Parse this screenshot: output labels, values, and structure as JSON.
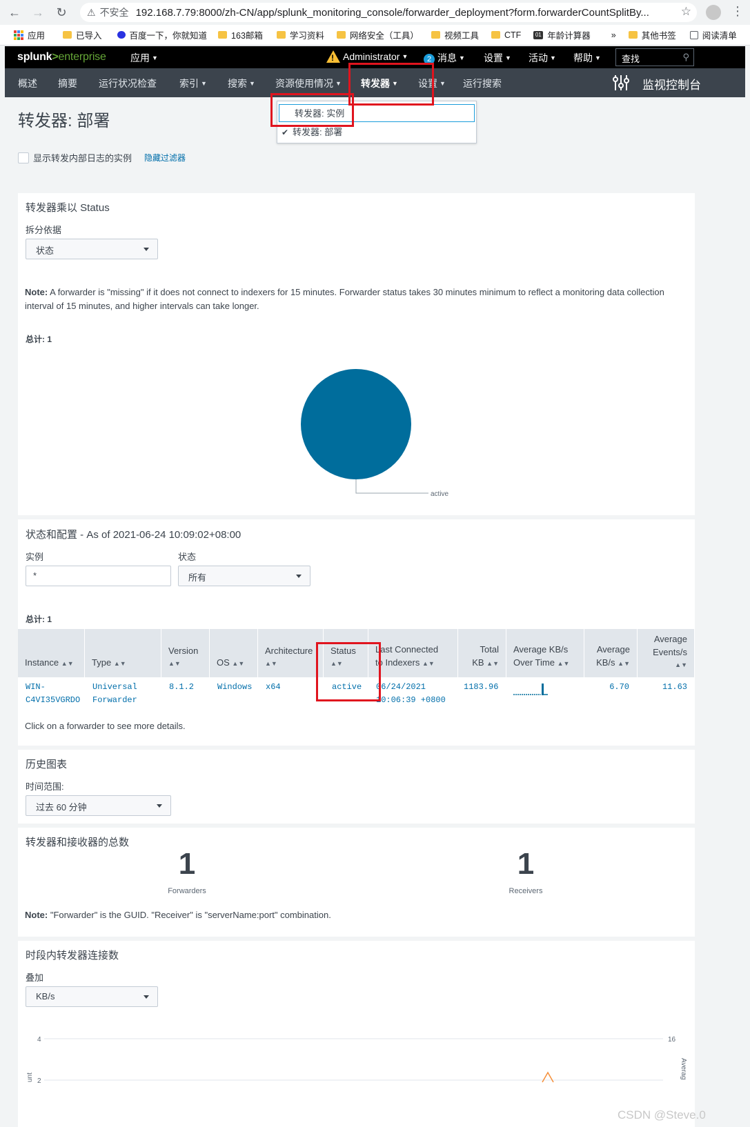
{
  "browser": {
    "insecure_label": "不安全",
    "url": "192.168.7.79:8000/zh-CN/app/splunk_monitoring_console/forwarder_deployment?form.forwarderCountSplitBy...",
    "bookmarks": [
      "应用",
      "已导入",
      "百度一下，你就知道",
      "163邮箱",
      "学习资料",
      "网络安全（工具）",
      "视频工具",
      "CTF",
      "年龄计算器"
    ],
    "more": "»",
    "other_bookmarks": "其他书签",
    "reading_list": "阅读清单"
  },
  "topbar": {
    "logo_splunk": "splunk",
    "logo_gt": ">",
    "logo_enterprise": "enterprise",
    "apps": "应用",
    "user": "Administrator",
    "messages_count": "2",
    "messages": "消息",
    "settings": "设置",
    "activity": "活动",
    "help": "帮助",
    "search_placeholder": "查找"
  },
  "subnav": {
    "items": [
      "概述",
      "摘要",
      "运行状况检查",
      "索引",
      "搜索",
      "资源使用情况",
      "转发器",
      "设置",
      "运行搜索"
    ],
    "console_title": "监视控制台"
  },
  "dropdown": {
    "item1": "转发器: 实例",
    "item2": "转发器: 部署"
  },
  "page": {
    "title": "转发器: 部署",
    "checkbox_label": "显示转发内部日志的实例",
    "hide_filter": "隐藏过滤器"
  },
  "panel1": {
    "title": "转发器乘以 Status",
    "split_label": "拆分依据",
    "split_value": "状态",
    "note_bold": "Note:",
    "note_line1": "A forwarder is \"missing\" if it does not connect to indexers for 15 minutes. Forwarder status takes 30 minutes minimum to reflect a monitoring data collection",
    "note_line2": "interval of 15 minutes, and higher intervals can take longer.",
    "total": "总计: 1",
    "pie_label": "active"
  },
  "chart_data": {
    "type": "pie",
    "categories": [
      "active"
    ],
    "values": [
      1
    ],
    "colors": [
      "#006d9c"
    ]
  },
  "panel2": {
    "title": "状态和配置",
    "title_suffix": " - As of 2021-06-24 10:09:02+08:00",
    "instance_label": "实例",
    "instance_value": "*",
    "status_label": "状态",
    "status_value": "所有",
    "total": "总计: 1",
    "headers": [
      [
        "",
        "Instance"
      ],
      [
        "",
        "Type"
      ],
      [
        "Version",
        ""
      ],
      [
        "",
        "OS"
      ],
      [
        "Architecture",
        ""
      ],
      [
        "Status",
        ""
      ],
      [
        "Last Connected",
        "to Indexers"
      ],
      [
        "Total",
        "KB"
      ],
      [
        "Average KB/s",
        "Over Time"
      ],
      [
        "Average",
        "KB/s"
      ],
      [
        "Average",
        "Events/s"
      ]
    ],
    "row": {
      "instance_1": "WIN-",
      "instance_2": "C4VI35VGRDO",
      "type_1": "Universal",
      "type_2": "Forwarder",
      "version": "8.1.2",
      "os": "Windows",
      "arch": "x64",
      "status": "active",
      "last_1": "06/24/2021",
      "last_2": "10:06:39 +0800",
      "total_kb": "1183.96",
      "avg_kbs": "6.70",
      "avg_events": "11.63"
    },
    "footer": "Click on a forwarder to see more details."
  },
  "panel3": {
    "title": "历史图表",
    "range_label": "时间范围:",
    "range_value": "过去 60 分钟"
  },
  "panel4": {
    "title": "转发器和接收器的总数",
    "forwarders_value": "1",
    "forwarders_label": "Forwarders",
    "receivers_value": "1",
    "receivers_label": "Receivers",
    "note_bold": "Note:",
    "note": "\"Forwarder\" is the GUID. \"Receiver\" is \"serverName:port\" combination."
  },
  "panel5": {
    "title": "时段内转发器连接数",
    "overlay_label": "叠加",
    "overlay_value": "KB/s",
    "y_left_top": "4",
    "y_left_next": "2",
    "y_right_top": "16",
    "y_left_axis": "unt",
    "y_right_axis": "Averag"
  },
  "watermark": "CSDN @Steve.0"
}
